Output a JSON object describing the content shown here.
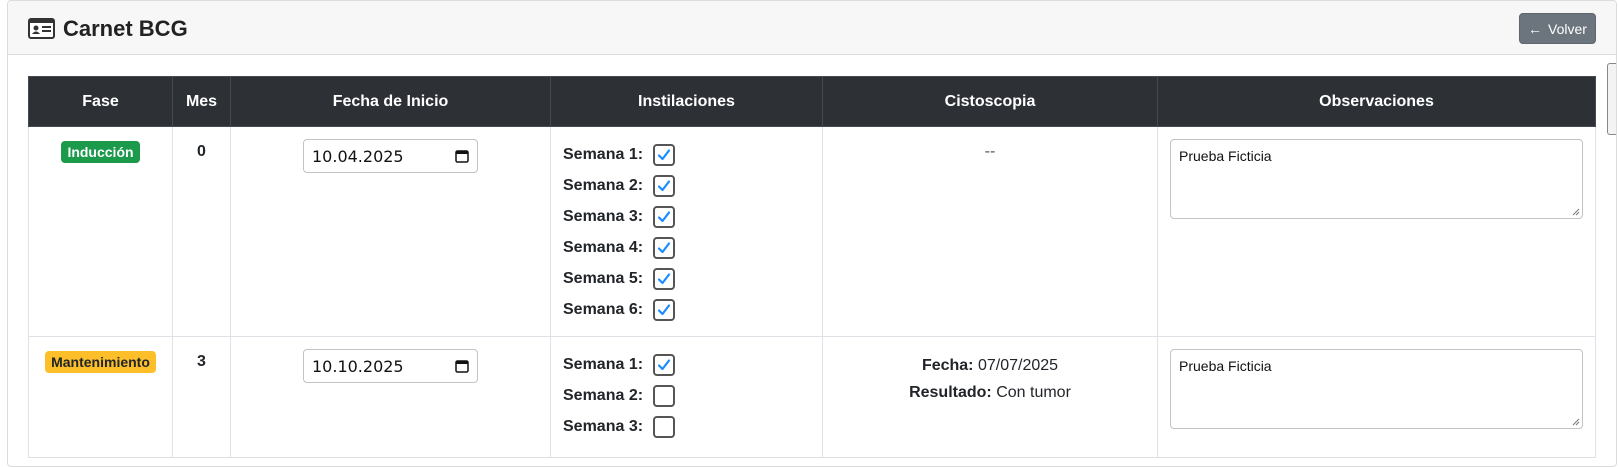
{
  "header": {
    "title": "Carnet BCG",
    "icon": "id-card-icon",
    "back_label": "Volver",
    "back_icon": "arrow-left-icon"
  },
  "table": {
    "columns": [
      "Fase",
      "Mes",
      "Fecha de Inicio",
      "Instilaciones",
      "Cistoscopia",
      "Observaciones"
    ],
    "rows": [
      {
        "fase": "Inducción",
        "fase_color": "#1a9a4a",
        "mes": "0",
        "fecha": "10.04.2025",
        "semanas": [
          {
            "label": "Semana 1:",
            "checked": true
          },
          {
            "label": "Semana 2:",
            "checked": true
          },
          {
            "label": "Semana 3:",
            "checked": true
          },
          {
            "label": "Semana 4:",
            "checked": true
          },
          {
            "label": "Semana 5:",
            "checked": true
          },
          {
            "label": "Semana 6:",
            "checked": true
          }
        ],
        "cistoscopia": "--",
        "observaciones": "Prueba Ficticia"
      },
      {
        "fase": "Mantenimiento",
        "fase_color": "#fcbf2a",
        "mes": "3",
        "fecha": "10.10.2025",
        "semanas": [
          {
            "label": "Semana 1:",
            "checked": true
          },
          {
            "label": "Semana 2:",
            "checked": false
          },
          {
            "label": "Semana 3:",
            "checked": false
          }
        ],
        "cistoscopia_fecha_label": "Fecha:",
        "cistoscopia_fecha": "07/07/2025",
        "cistoscopia_resultado_label": "Resultado:",
        "cistoscopia_resultado": "Con tumor",
        "observaciones": "Prueba Ficticia"
      }
    ]
  },
  "colors": {
    "header_bg": "#2d3136",
    "check_blue": "#1a8cff",
    "back_button": "#6c757d"
  }
}
